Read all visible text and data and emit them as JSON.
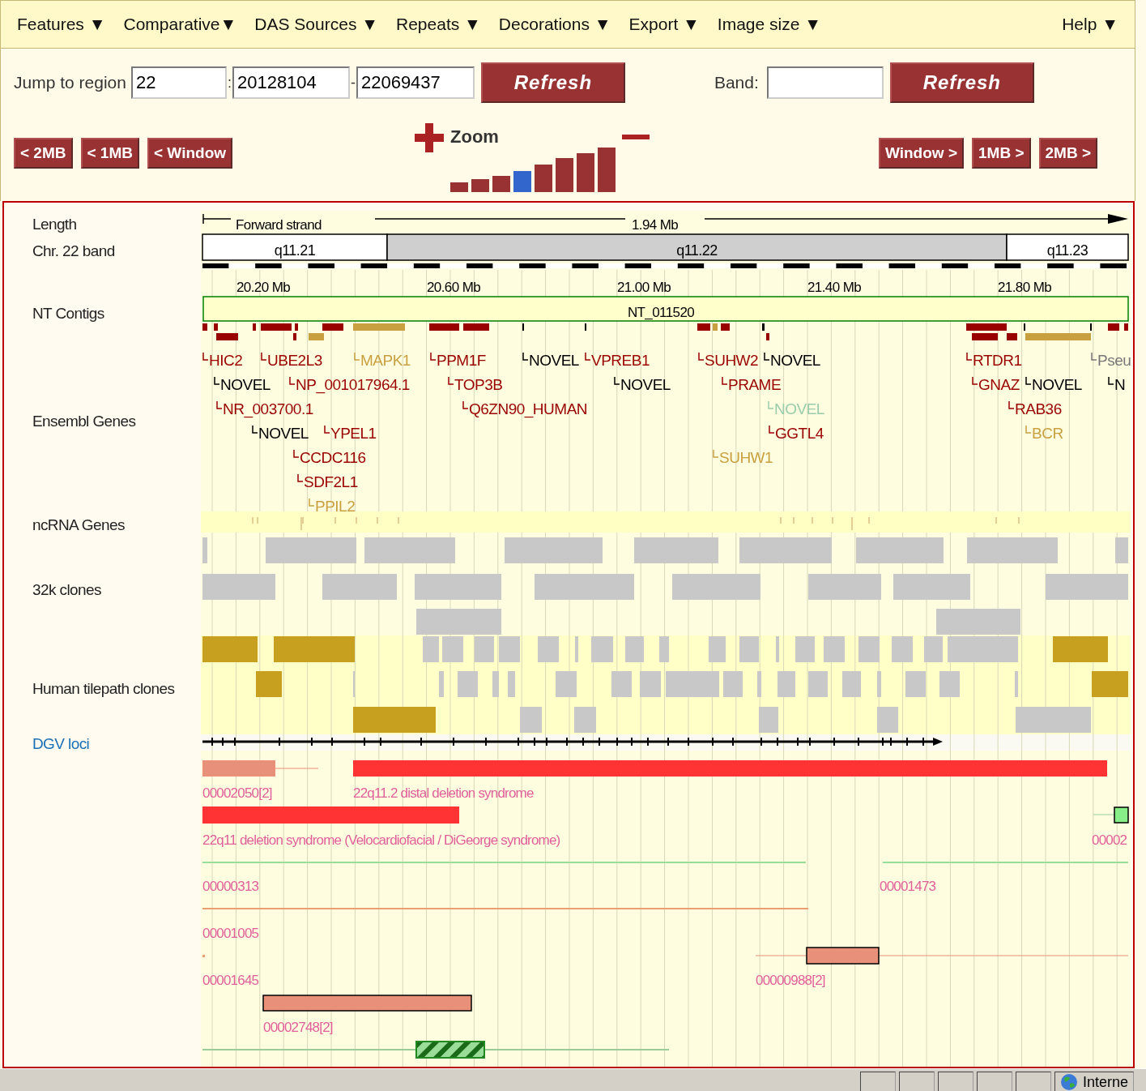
{
  "menu": [
    {
      "label": "Features ▼"
    },
    {
      "label": "Comparative▼"
    },
    {
      "label": "DAS Sources ▼"
    },
    {
      "label": "Repeats ▼"
    },
    {
      "label": "Decorations ▼"
    },
    {
      "label": "Export ▼"
    },
    {
      "label": "Image size ▼"
    },
    {
      "label": "Help ▼"
    }
  ],
  "region": {
    "label": "Jump to region",
    "chromosome": "22",
    "separator": ":",
    "start": "20128104",
    "dash": "-",
    "end": "22069437",
    "refresh": "Refresh"
  },
  "band_search": {
    "label": "Band:",
    "refresh": "Refresh"
  },
  "nav_left": [
    "< 2MB",
    "< 1MB",
    "< Window"
  ],
  "nav_right": [
    "Window >",
    "1MB >",
    "2MB >"
  ],
  "zoom": {
    "label": "Zoom",
    "levels": [
      {
        "selected": false
      },
      {
        "selected": false
      },
      {
        "selected": false
      },
      {
        "selected": true
      },
      {
        "selected": false
      },
      {
        "selected": false
      },
      {
        "selected": false
      },
      {
        "selected": false
      }
    ]
  },
  "track_labels": [
    {
      "label": "Length",
      "kind": "text"
    },
    {
      "label": "Chr. 22 band",
      "kind": "text"
    },
    {
      "label": "NT Contigs",
      "kind": "text"
    },
    {
      "label": "Ensembl Genes",
      "kind": "text"
    },
    {
      "label": "ncRNA Genes",
      "kind": "text"
    },
    {
      "label": "32k clones",
      "kind": "text"
    },
    {
      "label": "Human tilepath clones",
      "kind": "text"
    },
    {
      "label": "DGV loci",
      "kind": "link"
    }
  ],
  "length": {
    "strand": "Forward strand",
    "span": "1.94 Mb"
  },
  "bands": [
    {
      "label": "q11.21",
      "kind": "gneg"
    },
    {
      "label": "q11.22",
      "kind": "gpos"
    },
    {
      "label": "q11.23",
      "kind": "gneg"
    }
  ],
  "ticks": [
    "20.20 Mb",
    "20.60 Mb",
    "21.00 Mb",
    "21.40 Mb",
    "21.80 Mb"
  ],
  "contig": "NT_011520",
  "genes": [
    {
      "label": "HIC2",
      "color": "#990000"
    },
    {
      "label": "UBE2L3",
      "color": "#990000"
    },
    {
      "label": "MAPK1",
      "color": "#c8a040"
    },
    {
      "label": "PPM1F",
      "color": "#990000"
    },
    {
      "label": "NOVEL",
      "color": "#000000"
    },
    {
      "label": "VPREB1",
      "color": "#990000"
    },
    {
      "label": "SUHW2",
      "color": "#990000"
    },
    {
      "label": "NOVEL",
      "color": "#000000"
    },
    {
      "label": "RTDR1",
      "color": "#990000"
    },
    {
      "label": "Pseu",
      "color": "#777777"
    },
    {
      "label": "NOVEL",
      "color": "#000000"
    },
    {
      "label": "NP_001017964.1",
      "color": "#990000"
    },
    {
      "label": "TOP3B",
      "color": "#990000"
    },
    {
      "label": "NOVEL",
      "color": "#000000"
    },
    {
      "label": "PRAME",
      "color": "#990000"
    },
    {
      "label": "GNAZ",
      "color": "#990000"
    },
    {
      "label": "NOVEL",
      "color": "#000000"
    },
    {
      "label": "N",
      "color": "#000000"
    },
    {
      "label": "NR_003700.1",
      "color": "#990000"
    },
    {
      "label": "Q6ZN90_HUMAN",
      "color": "#990000"
    },
    {
      "label": "NOVEL",
      "color": "#99ccaa"
    },
    {
      "label": "RAB36",
      "color": "#990000"
    },
    {
      "label": "NOVEL",
      "color": "#000000"
    },
    {
      "label": "YPEL1",
      "color": "#990000"
    },
    {
      "label": "GGTL4",
      "color": "#990000"
    },
    {
      "label": "BCR",
      "color": "#c8a040"
    },
    {
      "label": "CCDC116",
      "color": "#990000"
    },
    {
      "label": "SUHW1",
      "color": "#c8a040"
    },
    {
      "label": "SDF2L1",
      "color": "#990000"
    },
    {
      "label": "PPIL2",
      "color": "#c8a040"
    }
  ],
  "dgv_features": [
    {
      "label": "00002050[2]",
      "color": "#e8907a"
    },
    {
      "label": "22q11.2 distal deletion syndrome",
      "color": "#ff3333"
    },
    {
      "label": "22q11 deletion syndrome (Velocardiofacial / DiGeorge syndrome)",
      "color": "#ff3333"
    },
    {
      "label": "00002",
      "color": "#88ee88"
    },
    {
      "label": "00000313",
      "color": "#99dd99"
    },
    {
      "label": "00001473",
      "color": "#99dd99"
    },
    {
      "label": "00001005",
      "color": "#e8a070"
    },
    {
      "label": "00001645",
      "color": "#e8a070"
    },
    {
      "label": "00000988[2]",
      "color": "#e8907a"
    },
    {
      "label": "00002748[2]",
      "color": "#e8907a"
    },
    {
      "kind": "hatched",
      "color": "#228822"
    }
  ],
  "status_bar": {
    "zone": "Interne"
  }
}
